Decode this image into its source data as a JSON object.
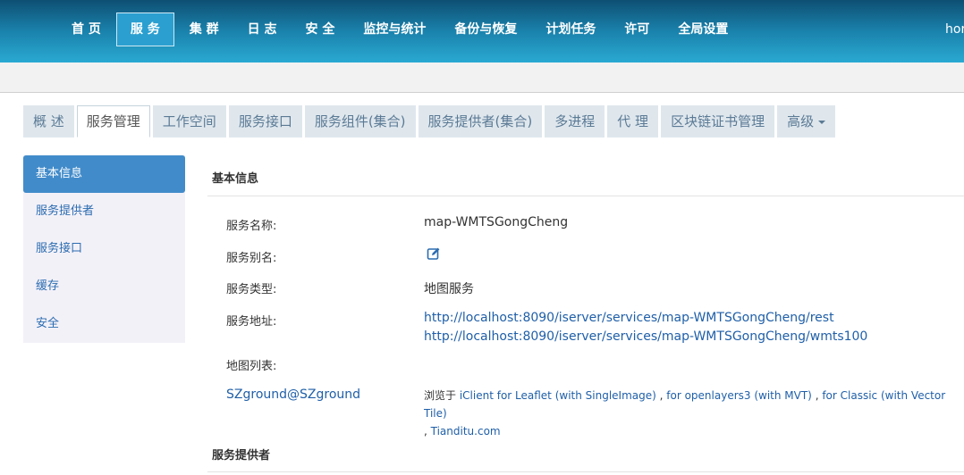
{
  "topnav": {
    "items": [
      {
        "label": "首 页"
      },
      {
        "label": "服 务"
      },
      {
        "label": "集 群"
      },
      {
        "label": "日 志"
      },
      {
        "label": "安 全"
      },
      {
        "label": "监控与统计"
      },
      {
        "label": "备份与恢复"
      },
      {
        "label": "计划任务"
      },
      {
        "label": "许可"
      },
      {
        "label": "全局设置"
      }
    ],
    "user_fragment": "hor"
  },
  "subtabs": {
    "items": [
      {
        "label": "概 述"
      },
      {
        "label": "服务管理"
      },
      {
        "label": "工作空间"
      },
      {
        "label": "服务接口"
      },
      {
        "label": "服务组件(集合)"
      },
      {
        "label": "服务提供者(集合)"
      },
      {
        "label": "多进程"
      },
      {
        "label": "代 理"
      },
      {
        "label": "区块链证书管理"
      },
      {
        "label": "高级"
      }
    ]
  },
  "sidebar": {
    "items": [
      {
        "label": "基本信息"
      },
      {
        "label": "服务提供者"
      },
      {
        "label": "服务接口"
      },
      {
        "label": "缓存"
      },
      {
        "label": "安全"
      }
    ]
  },
  "main": {
    "basic_info_title": "基本信息",
    "fields": {
      "name_label": "服务名称:",
      "name_value": "map-WMTSGongCheng",
      "alias_label": "服务别名:",
      "type_label": "服务类型:",
      "type_value": "地图服务",
      "address_label": "服务地址:",
      "address_1": "http://localhost:8090/iserver/services/map-WMTSGongCheng/rest",
      "address_2": "http://localhost:8090/iserver/services/map-WMTSGongCheng/wmts100",
      "maplist_label": "地图列表:"
    },
    "map": {
      "name": "SZground@SZground",
      "browse_prefix": "浏览于 ",
      "link_leaflet": "iClient for Leaflet (with SingleImage)",
      "sep1": " , ",
      "link_ol": "for openlayers3 (with MVT)",
      "sep2": " , ",
      "link_classic": "for Classic (with Vector Tile)",
      "sep3": " , ",
      "link_tianditu": "Tianditu.com"
    },
    "provider_title": "服务提供者"
  },
  "colors": {
    "nav_gradient_top": "#0e4f73",
    "nav_gradient_bottom": "#2aa9d2",
    "sidebar_active": "#418bca",
    "link": "#1f5fa8"
  },
  "icons": {
    "alias_edit": "edit-icon",
    "advanced_dropdown": "caret-down-icon"
  }
}
